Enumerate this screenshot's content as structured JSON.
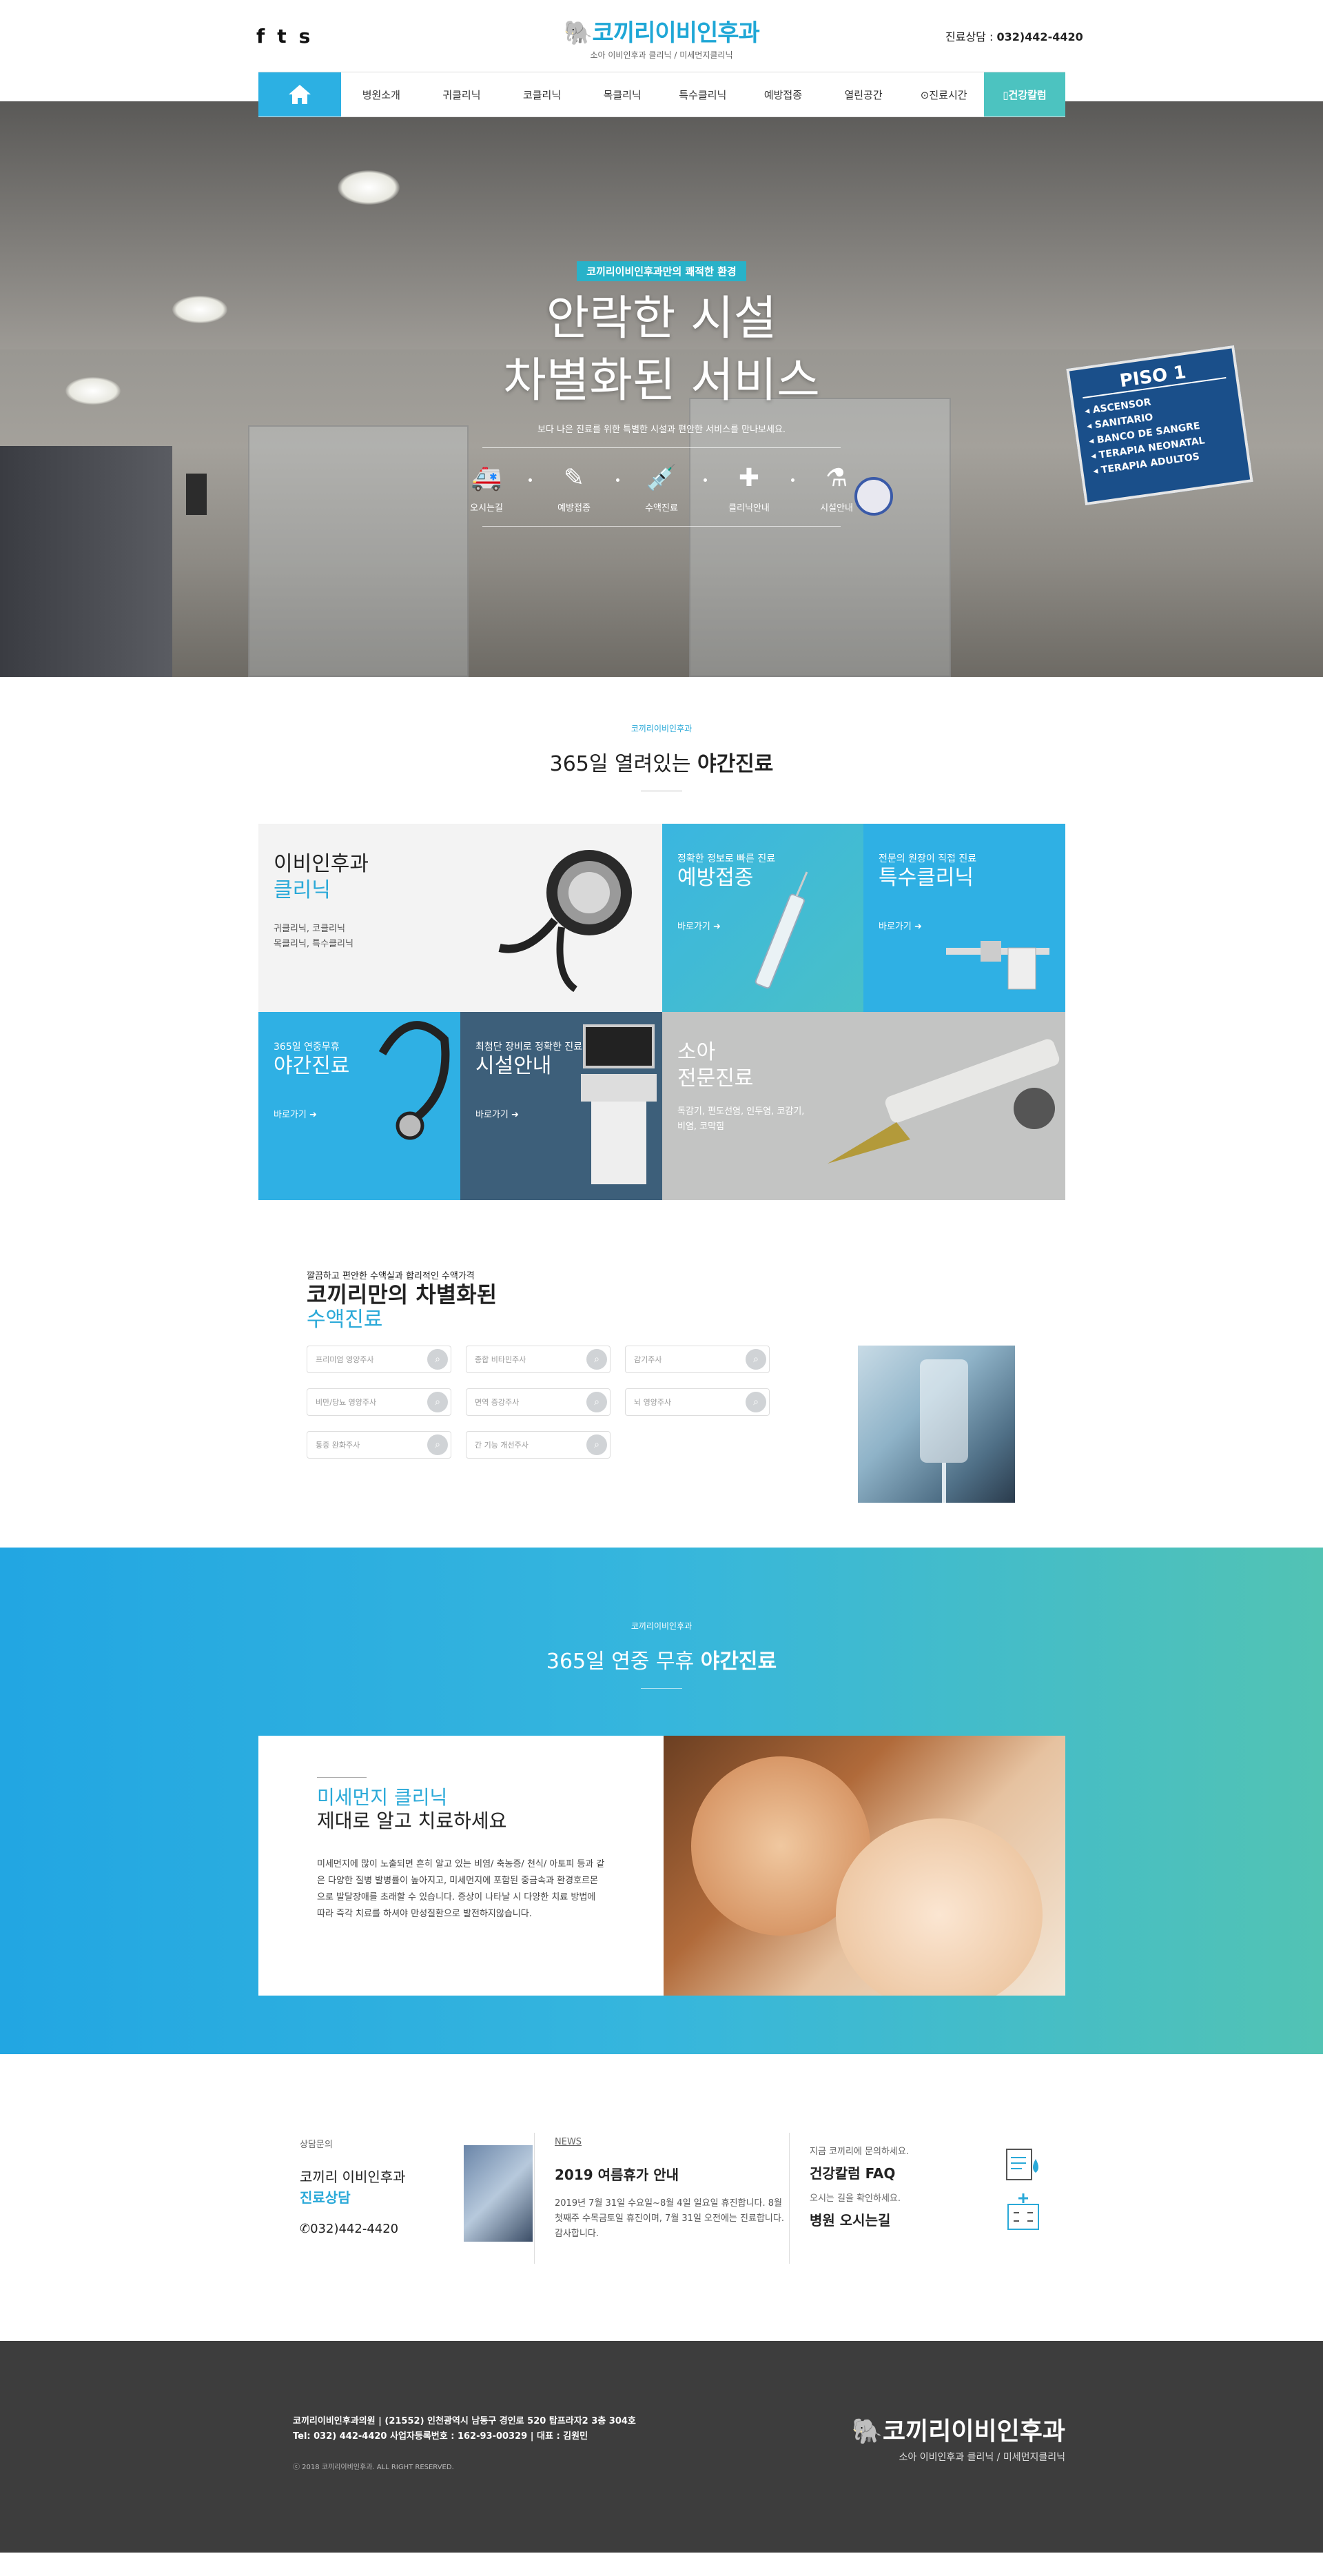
{
  "header": {
    "social": [
      "f",
      "t",
      "s"
    ],
    "logo_name": "코끼리이비인후과",
    "logo_sub": "소아 이비인후과 클리닉 / 미세먼지클리닉",
    "phone_label": "진료상담 : ",
    "phone": "032)442-4420"
  },
  "nav": {
    "home_icon": "home-icon",
    "items": [
      "병원소개",
      "귀클리닉",
      "코클리닉",
      "목클리닉",
      "특수클리닉",
      "예방접종",
      "열린공간",
      "⊙진료시간",
      "▯건강칼럼"
    ]
  },
  "hero": {
    "badge": "코끼리이비인후과만의 쾌적한 환경",
    "title1": "안락한 시설",
    "title2": "차별화된 서비스",
    "desc": "보다 나은 진료를 위한 특별한 시설과 편안한 서비스를 만나보세요.",
    "icons": [
      {
        "icon": "ambulance-icon",
        "glyph": "🚑",
        "label": "오시는길"
      },
      {
        "icon": "pencil-icon",
        "glyph": "✎",
        "label": "예방접종"
      },
      {
        "icon": "syringe-icon",
        "glyph": "💉",
        "label": "수액진료"
      },
      {
        "icon": "medkit-icon",
        "glyph": "✚",
        "label": "클리닉안내"
      },
      {
        "icon": "flask-icon",
        "glyph": "⚗",
        "label": "시설안내"
      }
    ],
    "sign_title": "PISO 1",
    "sign_rows": [
      "◂ ASCENSOR",
      "◂ SANITARIO",
      "◂ BANCO DE SANGRE",
      "◂ TERAPIA NEONATAL",
      "◂ TERAPIA ADULTOS"
    ]
  },
  "section2": {
    "small": "코끼리이비인후과",
    "title_pre": "365일 열려있는 ",
    "title_bold": "야간진료",
    "clinic": {
      "t1": "이비인후과",
      "t2": "클리닉",
      "desc1": "귀클리닉, 코클리닉",
      "desc2": "목클리닉, 특수클리닉"
    },
    "vaccine": {
      "label": "정확한 정보로 빠른 진료",
      "title": "예방접종",
      "more": "바로가기"
    },
    "special": {
      "label": "전문의 원장이 직접 진료",
      "title": "특수클리닉",
      "more": "바로가기"
    },
    "night": {
      "label": "365일 연중무휴",
      "title": "야간진료",
      "more": "바로가기"
    },
    "facility": {
      "label": "최첨단 장비로 정확한 진료",
      "title": "시설안내",
      "more": "바로가기"
    },
    "pediatric": {
      "t1": "소아",
      "t2": "전문진료",
      "desc1": "독감기, 편도선염, 인두염, 코감기,",
      "desc2": "비염, 코막힘"
    }
  },
  "section3": {
    "small": "깔끔하고 편안한 수액실과 합리적인 수액가격",
    "h1": "코끼리만의 차별화된",
    "h2": "수액진료",
    "pills": [
      "프리미엄 영양주사",
      "종합 비타민주사",
      "감기주사",
      "비만/당뇨 영양주사",
      "면역 증강주사",
      "뇌 영양주사",
      "통증 완화주사",
      "간 기능 개선주사"
    ]
  },
  "section4": {
    "small": "코끼리이비인후과",
    "title_pre": "365일 연중 무휴 ",
    "title_bold": "야간진료",
    "card_t1": "미세먼지 클리닉",
    "card_t2": "제대로 알고 치료하세요",
    "card_p": "미세먼지에 많이 노출되면 흔히 알고 있는 비염/ 축농증/ 천식/ 아토피 등과 같은 다양한 질병 발병률이 높아지고, 미세먼지에 포함된 중금속과 환경호르몬으로 발달장애를 초래할 수 있습니다. 증상이 나타날 시 다양한 치료 방법에 따라 즉각 치료를 하셔야 만성질환으로 발전하지않습니다."
  },
  "section5": {
    "counsel_small": "상담문의",
    "counsel_t1": "코끼리 이비인후과",
    "counsel_t2": "진료상담",
    "counsel_phone": "032)442-4420",
    "news_small": "NEWS",
    "news_title": "2019 여름휴가 안내",
    "news_body": "2019년 7월 31일 수요일~8월 4일 일요일 휴진합니다. 8월 첫째주 수목금토일 휴진이며, 7월 31일 오전에는 진료합니다. 감사합니다.",
    "faq_small": "지금 코끼리에 문의하세요.",
    "faq_title": "건강칼럼 FAQ",
    "map_small": "오시는 길을 확인하세요.",
    "map_title": "병원 오시는길"
  },
  "footer": {
    "line1": "코끼리이비인후과의원 | (21552) 인천광역시 남동구 경인로 520 탑프라자2 3층 304호",
    "line2": "Tel: 032) 442-4420 사업자등록번호 : 162-93-00329 | 대표 : 김원민",
    "copy": "ⓒ 2018 코끼리이비인후과. ALL RIGHT RESERVED.",
    "logo_name": "코끼리이비인후과",
    "logo_sub": "소아 이비인후과 클리닉 / 미세먼지클리닉"
  },
  "colors": {
    "accent": "#2cb0e3",
    "teal": "#4cc3c0",
    "gray_tile": "#c3c4c3",
    "navy_tile": "#3d5f7a"
  }
}
